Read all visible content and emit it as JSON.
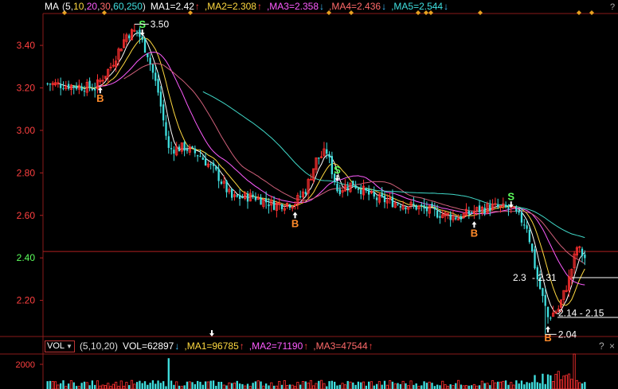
{
  "ma_bar": {
    "indicator": "MA",
    "params_open": "(",
    "params": [
      "5",
      "10",
      "20",
      "30",
      "60",
      "250"
    ],
    "params_close": ")",
    "items": [
      {
        "label": "MA1=2.42",
        "arrow": "↑",
        "color": "#ffffff",
        "arrow_color": "#ff4040"
      },
      {
        "label": ",MA2=2.308",
        "arrow": "↑",
        "color": "#ffd940",
        "arrow_color": "#ff4040"
      },
      {
        "label": ",MA3=2.358",
        "arrow": "↓",
        "color": "#ff5cff",
        "arrow_color": "#40c0ff"
      },
      {
        "label": ",MA4=2.436",
        "arrow": "↓",
        "color": "#ff6a6a",
        "arrow_color": "#40c0ff"
      },
      {
        "label": ",MA5=2.544",
        "arrow": "↓",
        "color": "#40e0e0",
        "arrow_color": "#40c0ff"
      }
    ]
  },
  "vol_bar": {
    "indicator": "VOL",
    "params": "(5,10,20)",
    "items": [
      {
        "label": "VOL=62897",
        "arrow": "↓",
        "color": "#ffffff",
        "arrow_color": "#40c0ff"
      },
      {
        "label": ",MA1=96785",
        "arrow": "↑",
        "color": "#ffd940",
        "arrow_color": "#ff4040"
      },
      {
        "label": ",MA2=71190",
        "arrow": "↑",
        "color": "#ff5cff",
        "arrow_color": "#ff4040"
      },
      {
        "label": ",MA3=47544",
        "arrow": "↑",
        "color": "#ff6a6a",
        "arrow_color": "#ff4040"
      }
    ],
    "help": "?",
    "close": "×"
  },
  "ma_help": "?",
  "colors": {
    "up": "#ff3030",
    "down": "#40e0e0",
    "ma1": "#ffffff",
    "ma2": "#ffd940",
    "ma3": "#ff5cff",
    "ma4": "#d0607a",
    "ma5": "#40d8c8",
    "grid": "#8a1a1a",
    "buy": "#ff8a2a",
    "sell": "#5cff5c"
  },
  "chart_data": {
    "type": "candlestick",
    "y_ticks": [
      "3.40",
      "3.20",
      "3.00",
      "2.80",
      "2.60",
      "2.40",
      "2.20"
    ],
    "ylim": [
      2.03,
      3.55
    ],
    "vol_ticks": [
      "2000"
    ],
    "annotations": [
      {
        "text": "3.50",
        "price": 3.5
      },
      {
        "text": "2.3",
        "price": 2.31
      },
      {
        "text": "- 2.31",
        "price": 2.31
      },
      {
        "text": "2.14 - 2.15",
        "price": 2.145
      },
      {
        "text": "2.04",
        "price": 2.04
      }
    ],
    "signals": [
      {
        "type": "B",
        "bar": 20
      },
      {
        "type": "S",
        "bar": 36
      },
      {
        "type": "B",
        "bar": 94
      },
      {
        "type": "S",
        "bar": 110
      },
      {
        "type": "B",
        "bar": 162
      },
      {
        "type": "S",
        "bar": 176
      },
      {
        "type": "B",
        "bar": 190
      }
    ]
  }
}
